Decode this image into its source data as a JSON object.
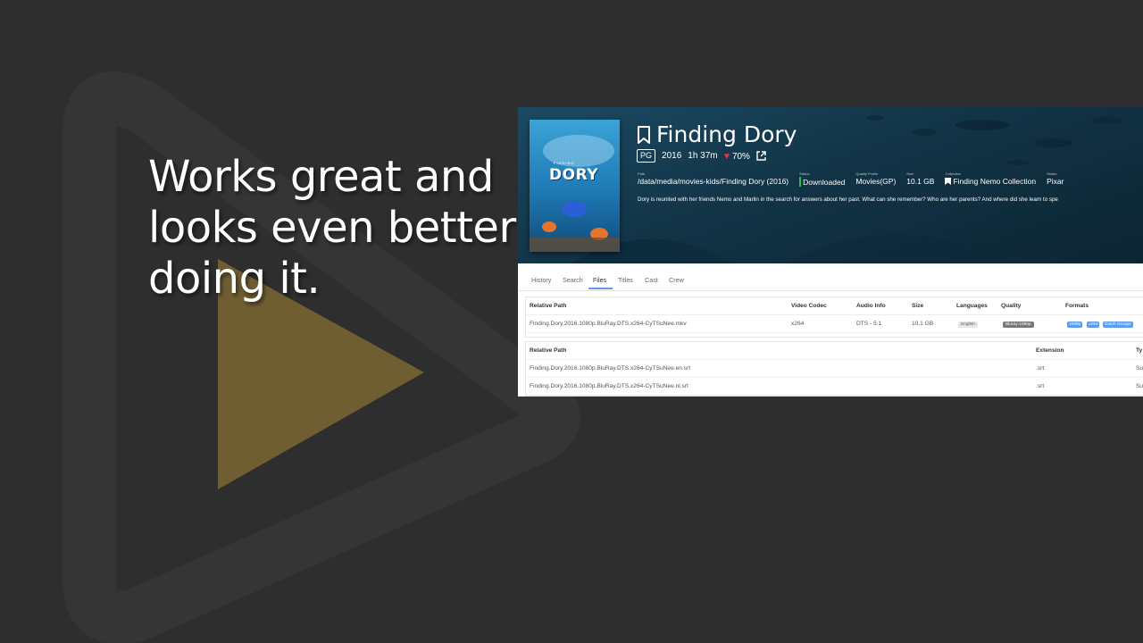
{
  "colors": {
    "background": "#2e2e2e",
    "accent_gold": "#c9a23a",
    "hero_blue": "#123447",
    "status_green": "#27c24c",
    "heart_red": "#e0343b",
    "badge_blue": "#5d9cec"
  },
  "tagline": {
    "lines": [
      "Works great and",
      "looks even better",
      "doing it."
    ]
  },
  "movie": {
    "title": "Finding Dory",
    "rating": "PG",
    "year": "2016",
    "runtime": "1h 37m",
    "score": "70%",
    "poster_text": "DORY",
    "poster_subtext": "FINDING",
    "meta": {
      "path_label": "Path",
      "path": "/data/media/movies-kids/Finding Dory (2016)",
      "status_label": "Status",
      "status": "Downloaded",
      "quality_label": "Quality Profile",
      "quality": "Movies(GP)",
      "size_label": "Size",
      "size": "10.1 GB",
      "collection_label": "Collection",
      "collection": "Finding Nemo Collection",
      "studio_label": "Studio",
      "studio": "Pixar"
    },
    "overview": "Dory is reunited with her friends Nemo and Marlin in the search for answers about her past. What can she remember? Who are her parents? And where did she learn to spe"
  },
  "tabs": [
    "History",
    "Search",
    "Files",
    "Titles",
    "Cast",
    "Crew"
  ],
  "active_tab": "Files",
  "files_table": {
    "headers": [
      "Relative Path",
      "Video Codec",
      "Audio Info",
      "Size",
      "Languages",
      "Quality",
      "Formats"
    ],
    "rows": [
      {
        "path": "Finding.Dory.2016.1080p.BluRay.DTS.x264-CyTSuNee.mkv",
        "codec": "x264",
        "audio": "DTS - 5.1",
        "size": "10.1 GB",
        "language": "English",
        "quality": "Bluray-1080p",
        "formats": [
          "1080p",
          "x264",
          "Dutch Groups"
        ]
      }
    ]
  },
  "extra_table": {
    "headers": [
      "Relative Path",
      "Extension",
      "Ty"
    ],
    "rows": [
      {
        "path": "Finding.Dory.2016.1080p.BluRay.DTS.x264-CyTSuNee.en.srt",
        "ext": ".srt",
        "type": "Su"
      },
      {
        "path": "Finding.Dory.2016.1080p.BluRay.DTS.x264-CyTSuNee.nl.srt",
        "ext": ".srt",
        "type": "Su"
      }
    ]
  }
}
